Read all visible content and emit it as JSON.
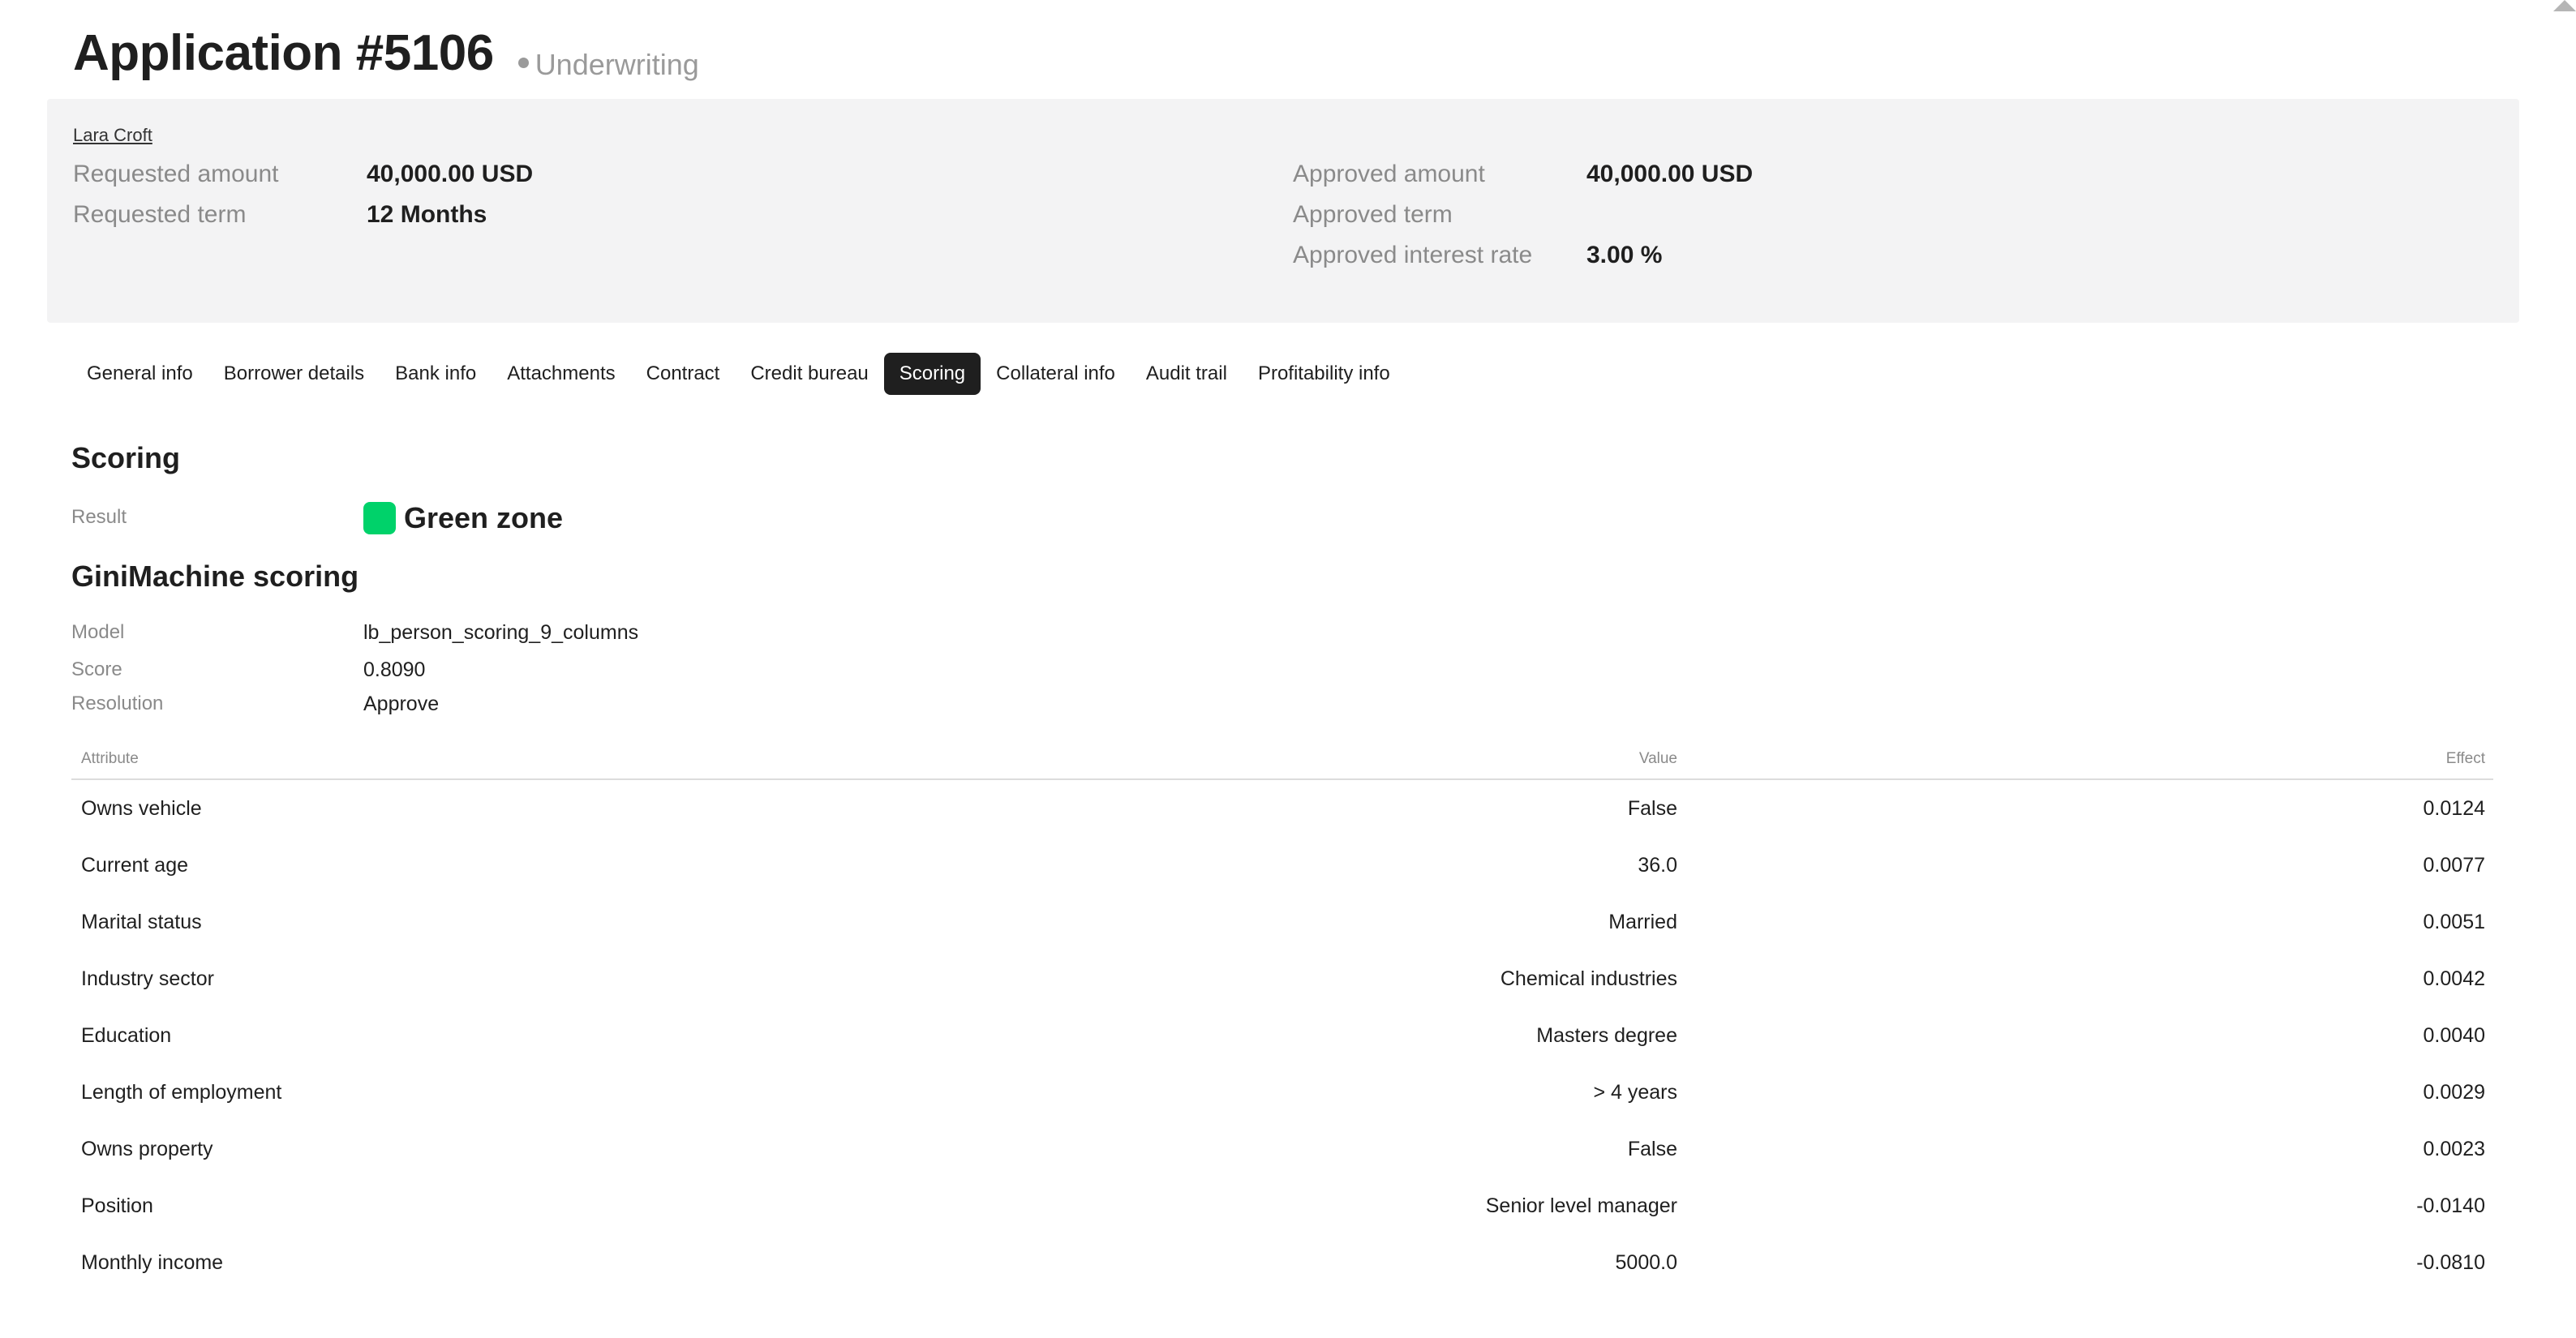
{
  "header": {
    "title": "Application #5106",
    "status": "Underwriting"
  },
  "summary": {
    "borrower": "Lara Croft",
    "left": [
      {
        "label": "Requested amount",
        "value": "40,000.00 USD"
      },
      {
        "label": "Requested term",
        "value": "12 Months"
      }
    ],
    "right": [
      {
        "label": "Approved amount",
        "value": "40,000.00 USD"
      },
      {
        "label": "Approved term",
        "value": ""
      },
      {
        "label": "Approved interest rate",
        "value": "3.00 %"
      }
    ]
  },
  "tabs": [
    {
      "label": "General info",
      "active": false
    },
    {
      "label": "Borrower details",
      "active": false
    },
    {
      "label": "Bank info",
      "active": false
    },
    {
      "label": "Attachments",
      "active": false
    },
    {
      "label": "Contract",
      "active": false
    },
    {
      "label": "Credit bureau",
      "active": false
    },
    {
      "label": "Scoring",
      "active": true
    },
    {
      "label": "Collateral info",
      "active": false
    },
    {
      "label": "Audit trail",
      "active": false
    },
    {
      "label": "Profitability info",
      "active": false
    }
  ],
  "scoring": {
    "title": "Scoring",
    "result_label": "Result",
    "result_value": "Green zone",
    "zone_color": "#00d26a"
  },
  "gini": {
    "title": "GiniMachine scoring",
    "model_label": "Model",
    "model_value": "lb_person_scoring_9_columns",
    "score_label": "Score",
    "score_value": "0.8090",
    "resolution_label": "Resolution",
    "resolution_value": "Approve"
  },
  "table": {
    "headers": {
      "attribute": "Attribute",
      "value": "Value",
      "effect": "Effect"
    },
    "rows": [
      {
        "attribute": "Owns vehicle",
        "value": "False",
        "effect": "0.0124"
      },
      {
        "attribute": "Current age",
        "value": "36.0",
        "effect": "0.0077"
      },
      {
        "attribute": "Marital status",
        "value": "Married",
        "effect": "0.0051"
      },
      {
        "attribute": "Industry sector",
        "value": "Chemical industries",
        "effect": "0.0042"
      },
      {
        "attribute": "Education",
        "value": "Masters degree",
        "effect": "0.0040"
      },
      {
        "attribute": "Length of employment",
        "value": "> 4 years",
        "effect": "0.0029"
      },
      {
        "attribute": "Owns property",
        "value": "False",
        "effect": "0.0023"
      },
      {
        "attribute": "Position",
        "value": "Senior level manager",
        "effect": "-0.0140"
      },
      {
        "attribute": "Monthly income",
        "value": "5000.0",
        "effect": "-0.0810"
      }
    ]
  }
}
